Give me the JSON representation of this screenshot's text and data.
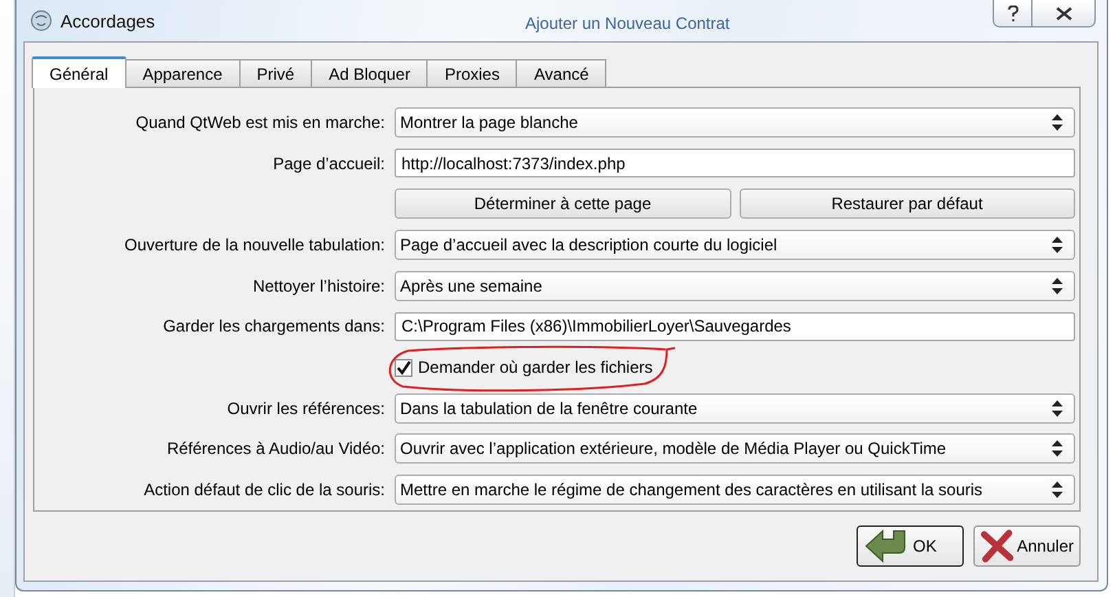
{
  "window": {
    "title": "Accordages",
    "background_title": "Ajouter un Nouveau Contrat"
  },
  "tabs": [
    {
      "label": "Général",
      "selected": true
    },
    {
      "label": "Apparence",
      "selected": false
    },
    {
      "label": "Privé",
      "selected": false
    },
    {
      "label": "Ad Bloquer",
      "selected": false
    },
    {
      "label": "Proxies",
      "selected": false
    },
    {
      "label": "Avancé",
      "selected": false
    }
  ],
  "rows": [
    {
      "kind": "select",
      "label": "Quand QtWeb est mis en marche:",
      "value": "Montrer la page blanche"
    },
    {
      "kind": "text",
      "label": "Page d’accueil:",
      "value": "http://localhost:7373/index.php"
    },
    {
      "kind": "buttons",
      "buttons": [
        "Déterminer à cette page",
        "Restaurer par défaut"
      ]
    },
    {
      "kind": "select",
      "label": "Ouverture de la nouvelle tabulation:",
      "value": "Page d’accueil avec la description courte du logiciel"
    },
    {
      "kind": "select",
      "label": "Nettoyer l’histoire:",
      "value": "Après une semaine"
    },
    {
      "kind": "text",
      "label": "Garder les chargements dans:",
      "value": "C:\\Program Files (x86)\\ImmobilierLoyer\\Sauvegardes"
    },
    {
      "kind": "checkbox",
      "label": "Demander où garder les fichiers",
      "checked": true
    },
    {
      "kind": "select",
      "label": "Ouvrir les références:",
      "value": "Dans la tabulation de la fenêtre courante"
    },
    {
      "kind": "select",
      "label": "Références à Audio/au Vidéo:",
      "value": "Ouvrir avec l’application extérieure, modèle de Média Player ou QuickTime"
    },
    {
      "kind": "select",
      "label": "Action défaut de clic de la souris:",
      "value": "Mettre en marche le régime de changement des caractères en utilisant la souris"
    }
  ],
  "buttons": [
    {
      "kind": "ok",
      "label": "OK"
    },
    {
      "kind": "cancel",
      "label": "Annuler"
    }
  ]
}
